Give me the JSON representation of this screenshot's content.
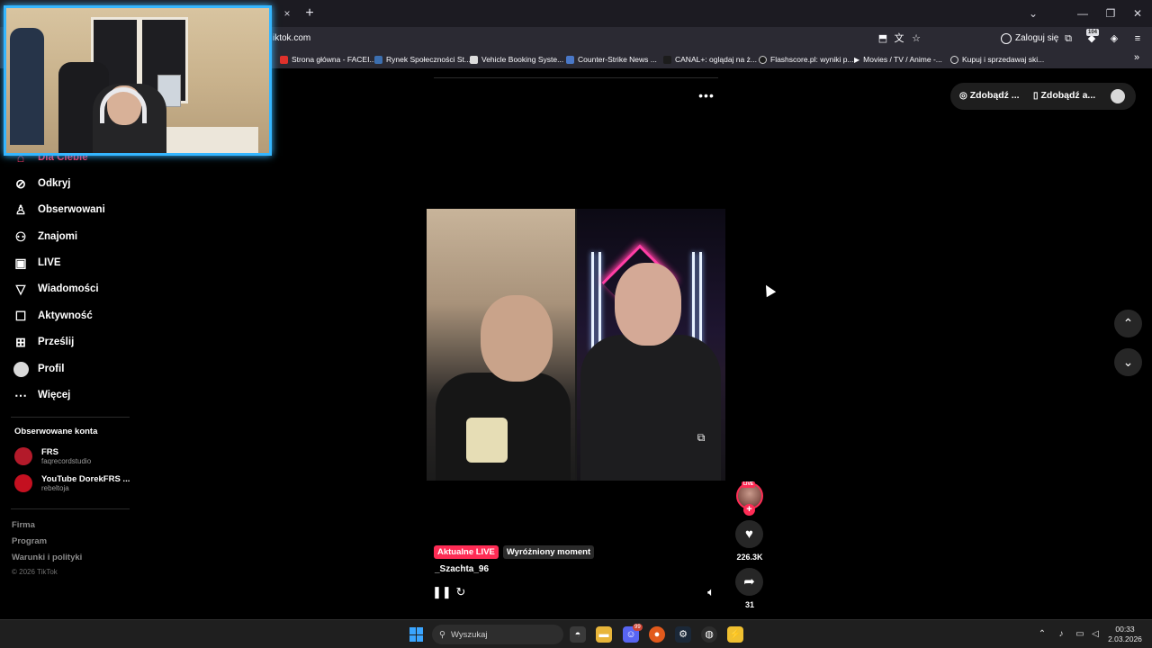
{
  "browser": {
    "tab_close": "×",
    "tab_new": "+",
    "url": "iktok.com",
    "login_label": "Zaloguj się",
    "extension_badge": "104",
    "window_controls": [
      "⌄",
      "—",
      "❐",
      "✕"
    ]
  },
  "bookmarks": [
    {
      "label": "Strona główna - FACEI...",
      "icon": "facebook-icon",
      "color": "#e0312b"
    },
    {
      "label": "Rynek Społeczności St...",
      "icon": "steam-icon",
      "color": "#3c6fb0"
    },
    {
      "label": "Vehicle Booking Syste...",
      "icon": "calendar-icon",
      "color": "#dddddd"
    },
    {
      "label": "Counter-Strike News ...",
      "icon": "hltv-icon",
      "color": "#4a78c8"
    },
    {
      "label": "CANAL+: oglądaj na ż...",
      "icon": "canal-icon",
      "color": "#1c1c1c"
    },
    {
      "label": "Flashscore.pl: wyniki p...",
      "icon": "flashscore-icon",
      "color": "#1c1c1c"
    },
    {
      "label": "Movies / TV / Anime -...",
      "icon": "play-icon",
      "color": "#1c1c1c"
    },
    {
      "label": "Kupuj i sprzedawaj ski...",
      "icon": "globe-icon",
      "color": "#1c1c1c"
    }
  ],
  "header": {
    "more_dots": "•••",
    "get_items": [
      {
        "label": "Zdobądź ...",
        "icon": "coin-icon"
      },
      {
        "label": "Zdobądź a...",
        "icon": "phone-icon"
      }
    ]
  },
  "sidebar": {
    "active_item": "Dla Ciebie",
    "items": [
      {
        "label": "Odkryj",
        "icon": "compass-icon"
      },
      {
        "label": "Obserwowani",
        "icon": "following-icon"
      },
      {
        "label": "Znajomi",
        "icon": "friends-icon"
      },
      {
        "label": "LIVE",
        "icon": "live-icon"
      },
      {
        "label": "Wiadomości",
        "icon": "send-icon"
      },
      {
        "label": "Aktywność",
        "icon": "activity-icon"
      },
      {
        "label": "Prześlij",
        "icon": "upload-icon"
      },
      {
        "label": "Profil",
        "icon": "profile-icon"
      },
      {
        "label": "Więcej",
        "icon": "more-icon"
      }
    ],
    "following_title": "Obserwowane konta",
    "accounts": [
      {
        "name": "FRS",
        "handle": "faqrecordstudio",
        "color": "#b31a2a"
      },
      {
        "name": "YouTube DorekFRS ...",
        "handle": "rebeltoja",
        "color": "#c41020"
      }
    ],
    "footer": [
      "Firma",
      "Program",
      "Warunki i polityki"
    ],
    "copyright": "© 2026 TikTok"
  },
  "video": {
    "live_tag": "LIVE",
    "follow": "+",
    "likes": "226.3K",
    "shares": "31",
    "badge_live": "Aktualne LIVE",
    "badge_highlight": "Wyróżniony moment",
    "username": "_Szachta_96"
  },
  "taskbar": {
    "search_placeholder": "Wyszukaj",
    "discord_badge": "99",
    "time": "00:33",
    "date": "2.03.2026"
  },
  "colors": {
    "accent": "#fe2c55",
    "webcam_border": "#35b6ff"
  }
}
